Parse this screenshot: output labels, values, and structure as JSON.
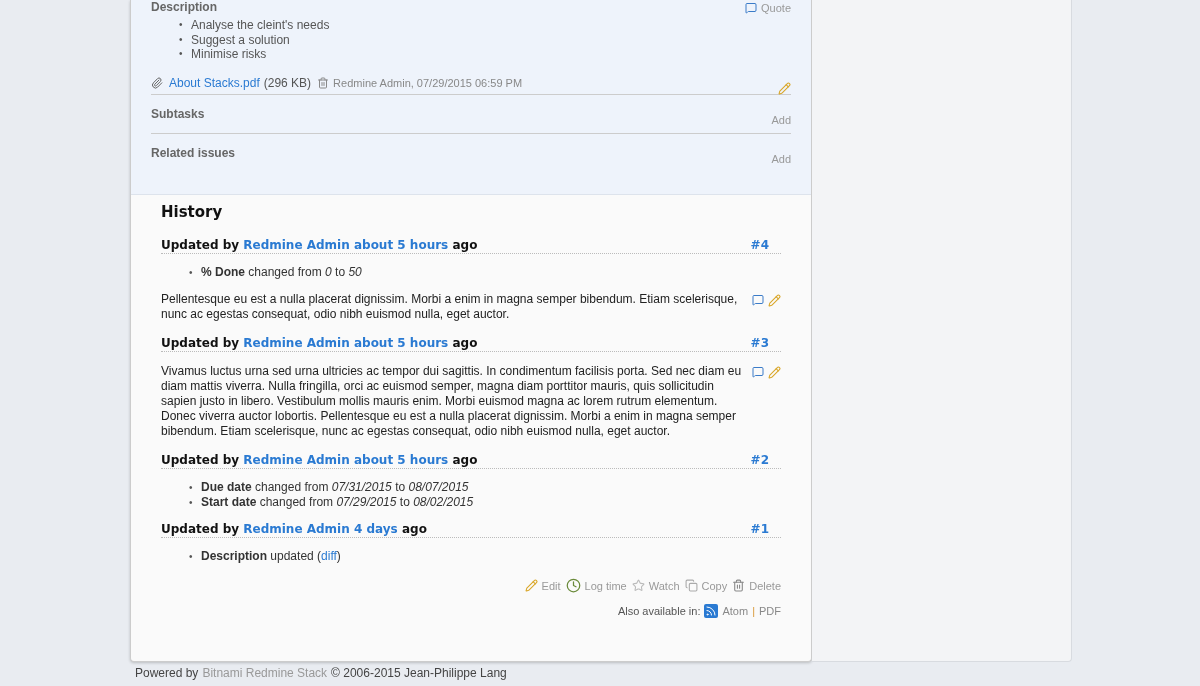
{
  "issue": {
    "description_label": "Description",
    "quote": "Quote",
    "description_items": [
      {
        "marker": "•",
        "text": "Analyse the cleint's needs"
      },
      {
        "marker": "•",
        "text": "Suggest a solution"
      },
      {
        "marker": "•",
        "text": "Minimise risks"
      }
    ],
    "attachment": {
      "filename": "About Stacks.pdf",
      "size": "(296 KB)",
      "author_date": "Redmine Admin, 07/29/2015 06:59 PM"
    },
    "sections": [
      {
        "title": "Subtasks",
        "action": "Add"
      },
      {
        "title": "Related issues",
        "action": "Add"
      }
    ]
  },
  "history": {
    "title": "History",
    "journals": [
      {
        "prefix": "Updated by",
        "author": "Redmine Admin",
        "age": "about 5 hours",
        "suffix": "ago",
        "number": "#4",
        "details": [
          {
            "kind": "change",
            "marker": "•",
            "text": "**% Done** changed from *0* to *50*"
          }
        ],
        "notes": "Pellentesque eu est a nulla placerat dignissim. Morbi a enim in magna semper bibendum. Etiam scelerisque, nunc ac egestas consequat, odio nibh euismod nulla, eget auctor."
      },
      {
        "prefix": "Updated by",
        "author": "Redmine Admin",
        "age": "about 5 hours",
        "suffix": "ago",
        "number": "#3",
        "notes": "Vivamus luctus urna sed urna ultricies ac tempor dui sagittis. In condimentum facilisis porta. Sed nec diam eu diam mattis viverra. Nulla fringilla, orci ac euismod semper, magna diam porttitor mauris, quis sollicitudin sapien justo in libero. Vestibulum mollis mauris enim. Morbi euismod magna ac lorem rutrum elementum. Donec viverra auctor lobortis. Pellentesque eu est a nulla placerat dignissim. Morbi a enim in magna semper bibendum. Etiam scelerisque, nunc ac egestas consequat, odio nibh euismod nulla, eget auctor."
      },
      {
        "prefix": "Updated by",
        "author": "Redmine Admin",
        "age": "about 5 hours",
        "suffix": "ago",
        "number": "#2",
        "details": [
          {
            "kind": "change",
            "marker": "•",
            "text": "**Due date** changed from *07/31/2015* to *08/07/2015*"
          },
          {
            "kind": "change",
            "marker": "•",
            "text": "**Start date** changed from *07/29/2015* to *08/02/2015*"
          }
        ]
      },
      {
        "prefix": "Updated by",
        "author": "Redmine Admin",
        "age": "4 days",
        "suffix": "ago",
        "number": "#1",
        "details": [
          {
            "kind": "diff",
            "marker": "•",
            "text": "**Description** updated (",
            "link": "diff",
            "after": ")"
          }
        ]
      }
    ]
  },
  "actions": [
    {
      "kind": "edit",
      "label": "Edit"
    },
    {
      "kind": "log-time",
      "label": "Log time"
    },
    {
      "kind": "watch",
      "label": "Watch"
    },
    {
      "kind": "copy",
      "label": "Copy"
    },
    {
      "kind": "delete",
      "label": "Delete"
    }
  ],
  "formats": {
    "label": "Also available in:",
    "links": [
      "Atom",
      "PDF"
    ],
    "separator": "|"
  },
  "footer": {
    "prefix": "Powered by",
    "link": "Bitnami Redmine Stack",
    "suffix": "© 2006-2015 Jean-Philippe Lang"
  }
}
